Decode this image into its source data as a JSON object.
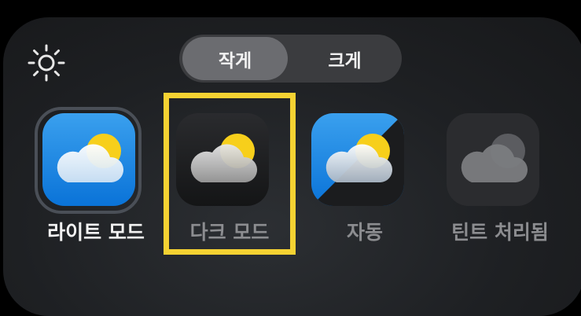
{
  "size_toggle": {
    "small_label": "작게",
    "large_label": "크게",
    "selected": "작게"
  },
  "brightness": {
    "icon": "sun-icon"
  },
  "appearance_options": [
    {
      "label": "라이트 모드",
      "icon": "weather-light-icon",
      "selected": true
    },
    {
      "label": "다크 모드",
      "icon": "weather-dark-icon",
      "selected": false,
      "highlighted": true
    },
    {
      "label": "자동",
      "icon": "weather-auto-icon",
      "selected": false
    },
    {
      "label": "틴트 처리됨",
      "icon": "weather-tinted-icon",
      "selected": false
    }
  ],
  "colors": {
    "highlight": "#f5d232",
    "label_selected": "#f2f2f2",
    "label_unselected": "#8c8d90",
    "sun": "#f7cf1b",
    "light_bg": "#1b8fe3"
  }
}
